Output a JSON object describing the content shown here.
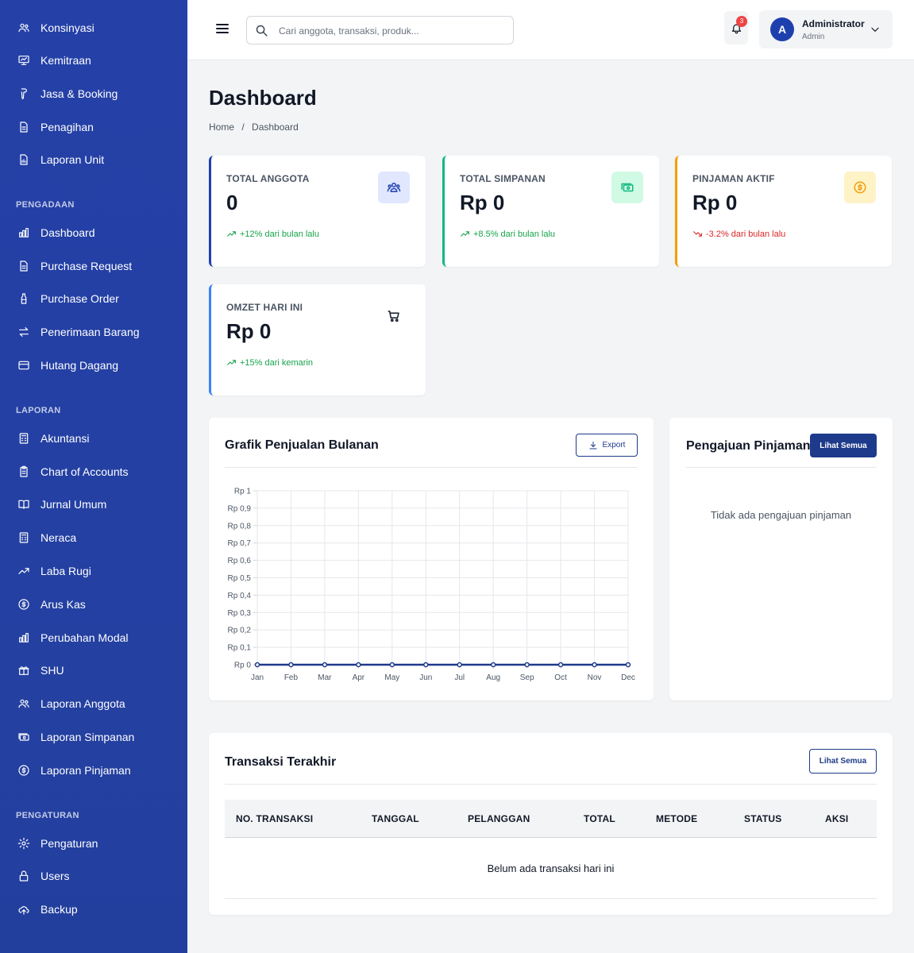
{
  "sidebar": {
    "items": [
      {
        "label": "Konsinyasi",
        "icon": "users-icon"
      },
      {
        "label": "Kemitraan",
        "icon": "presentation-icon"
      },
      {
        "label": "Jasa & Booking",
        "icon": "hair-dryer-icon"
      },
      {
        "label": "Penagihan",
        "icon": "document-icon"
      },
      {
        "label": "Laporan Unit",
        "icon": "file-chart-icon"
      }
    ],
    "sections": [
      {
        "title": "PENGADAAN",
        "items": [
          {
            "label": "Dashboard",
            "icon": "bar-chart-icon"
          },
          {
            "label": "Purchase Request",
            "icon": "document-icon"
          },
          {
            "label": "Purchase Order",
            "icon": "bottle-icon"
          },
          {
            "label": "Penerimaan Barang",
            "icon": "swap-arrows-icon"
          },
          {
            "label": "Hutang Dagang",
            "icon": "credit-card-icon"
          }
        ]
      },
      {
        "title": "LAPORAN",
        "items": [
          {
            "label": "Akuntansi",
            "icon": "calculator-icon"
          },
          {
            "label": "Chart of Accounts",
            "icon": "clipboard-icon"
          },
          {
            "label": "Jurnal Umum",
            "icon": "book-open-icon"
          },
          {
            "label": "Neraca",
            "icon": "calculator-icon"
          },
          {
            "label": "Laba Rugi",
            "icon": "trending-up-icon"
          },
          {
            "label": "Arus Kas",
            "icon": "dollar-circle-icon"
          },
          {
            "label": "Perubahan Modal",
            "icon": "bar-chart-icon"
          },
          {
            "label": "SHU",
            "icon": "gift-icon"
          },
          {
            "label": "Laporan Anggota",
            "icon": "users-icon"
          },
          {
            "label": "Laporan Simpanan",
            "icon": "cash-icon"
          },
          {
            "label": "Laporan Pinjaman",
            "icon": "dollar-circle-icon"
          }
        ]
      },
      {
        "title": "PENGATURAN",
        "items": [
          {
            "label": "Pengaturan",
            "icon": "gear-icon"
          },
          {
            "label": "Users",
            "icon": "lock-icon"
          },
          {
            "label": "Backup",
            "icon": "cloud-upload-icon"
          }
        ]
      }
    ]
  },
  "topbar": {
    "search_placeholder": "Cari anggota, transaksi, produk...",
    "notification_count": "3",
    "user": {
      "initial": "A",
      "name": "Administrator",
      "role": "Admin"
    }
  },
  "page": {
    "title": "Dashboard",
    "breadcrumb": [
      "Home",
      "/",
      "Dashboard"
    ]
  },
  "stats": [
    {
      "label": "TOTAL ANGGOTA",
      "value": "0",
      "trend": "+12% dari bulan lalu",
      "direction": "up",
      "accent": "#1e40af",
      "icon": "users-icon",
      "icon_color": "#1e40af",
      "icon_bg": "#e0e7ff"
    },
    {
      "label": "TOTAL SIMPANAN",
      "value": "Rp 0",
      "trend": "+8.5% dari bulan lalu",
      "direction": "up",
      "accent": "#10b981",
      "icon": "cash-icon",
      "icon_color": "#10b981",
      "icon_bg": "#d1fae5"
    },
    {
      "label": "PINJAMAN AKTIF",
      "value": "Rp 0",
      "trend": "-3.2% dari bulan lalu",
      "direction": "down",
      "accent": "#f59e0b",
      "icon": "dollar-circle-icon",
      "icon_color": "#f59e0b",
      "icon_bg": "#fef3c7"
    },
    {
      "label": "OMZET HARI INI",
      "value": "Rp 0",
      "trend": "+15% dari kemarin",
      "direction": "up",
      "accent": "#3b82f6",
      "icon": "cart-icon",
      "icon_color": "#111827",
      "icon_bg": "#ffffff"
    }
  ],
  "sales_chart": {
    "title": "Grafik Penjualan Bulanan",
    "export_label": "Export"
  },
  "chart_data": {
    "type": "line",
    "title": "Grafik Penjualan Bulanan",
    "xlabel": "",
    "ylabel": "",
    "categories": [
      "Jan",
      "Feb",
      "Mar",
      "Apr",
      "May",
      "Jun",
      "Jul",
      "Aug",
      "Sep",
      "Oct",
      "Nov",
      "Dec"
    ],
    "values": [
      0,
      0,
      0,
      0,
      0,
      0,
      0,
      0,
      0,
      0,
      0,
      0
    ],
    "ylim": [
      0,
      1
    ],
    "y_ticks": [
      "Rp 0",
      "Rp 0,1",
      "Rp 0,2",
      "Rp 0,3",
      "Rp 0,4",
      "Rp 0,5",
      "Rp 0,6",
      "Rp 0,7",
      "Rp 0,8",
      "Rp 0,9",
      "Rp 1"
    ],
    "grid": true,
    "line_color": "#1e3a8a"
  },
  "loans": {
    "title": "Pengajuan Pinjaman",
    "view_all": "Lihat Semua",
    "empty": "Tidak ada pengajuan pinjaman"
  },
  "transactions": {
    "title": "Transaksi Terakhir",
    "view_all": "Lihat Semua",
    "columns": [
      "NO. TRANSAKSI",
      "TANGGAL",
      "PELANGGAN",
      "TOTAL",
      "METODE",
      "STATUS",
      "AKSI"
    ],
    "empty": "Belum ada transaksi hari ini"
  },
  "colors": {
    "sidebar_bg": "#2541a8",
    "primary": "#1e3a8a",
    "page_bg": "#f3f4f6",
    "positive": "#16a34a",
    "negative": "#dc2626"
  }
}
